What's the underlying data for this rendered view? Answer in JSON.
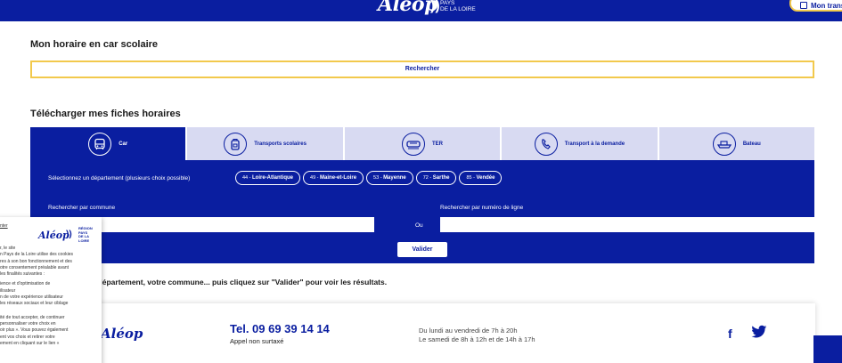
{
  "header": {
    "logo": "Aléop",
    "region": [
      "PAYS",
      "DE LA",
      "LOIRE"
    ],
    "transport_button": "Mon transport"
  },
  "search_section": {
    "title": "Mon horaire en car scolaire",
    "search_label": "Rechercher"
  },
  "download_section": {
    "title": "Télécharger mes fiches horaires",
    "tabs": [
      {
        "label": "Car",
        "icon": "bus-icon"
      },
      {
        "label": "Transports scolaires",
        "icon": "school-bag-icon"
      },
      {
        "label": "TER",
        "icon": "train-icon"
      },
      {
        "label": "Transport à la demande",
        "icon": "phone-bus-icon"
      },
      {
        "label": "Bateau",
        "icon": "boat-icon"
      }
    ],
    "department_label": "Sélectionnez un département (plusieurs choix possible)",
    "departments": [
      {
        "code": "44",
        "name": "Loire-Atlantique"
      },
      {
        "code": "49",
        "name": "Maine-et-Loire"
      },
      {
        "code": "53",
        "name": "Mayenne"
      },
      {
        "code": "72",
        "name": "Sarthe"
      },
      {
        "code": "85",
        "name": "Vendée"
      }
    ],
    "commune_label": "Rechercher par commune",
    "line_label": "Rechercher par numéro de ligne",
    "or_label": "Ou",
    "submit_label": "Valider",
    "hint": "transport ou votre département, votre commune... puis cliquez sur \"Valider\" pour voir les résultats."
  },
  "footer": {
    "logo": "Aléop",
    "phone": "Tel. 09 69 39 14 14",
    "phone_note": "Appel non surtaxé",
    "hours_weekday": "Du lundi au vendredi de 7h à 20h",
    "hours_saturday": "Le samedi de 8h à 12h et de 14h à 17h",
    "social": [
      "facebook-icon",
      "twitter-icon"
    ]
  },
  "cookie_banner": {
    "link": "nter",
    "logo": "Aléop",
    "region": [
      "RÉGION",
      "PAYS",
      "DE LA",
      "LOIRE"
    ],
    "lines": [
      "r, le site",
      "n Pays de la Loire utilise des cookies",
      "res à son bon fonctionnement et des",
      "otre consentement préalable avant",
      "les finalités suivantes :",
      "",
      "ience et d'optimisation de",
      "ilisateur",
      "n de votre expérience utilisateur",
      "les réseaux sociaux et leur ciblage",
      "",
      "",
      "ité de tout accepter, de continuer",
      "personnaliser votre choix en",
      "oir plus ». Vous pouvez également",
      "ent vos choix et retirer votre",
      "ement en cliquant sur le lien «"
    ]
  },
  "colors": {
    "brand_blue": "#0a1ea0",
    "tab_inactive": "#d8daf2",
    "accent_yellow": "#f2c94c"
  }
}
